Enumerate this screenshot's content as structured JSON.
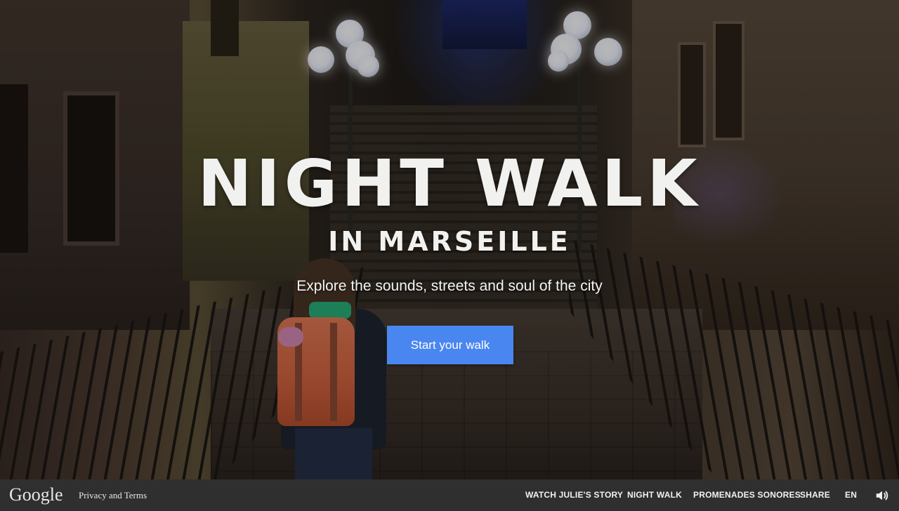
{
  "hero": {
    "title": "NIGHT WALK",
    "subtitle": "IN MARSEILLE",
    "tagline": "Explore the sounds, streets and soul of the city",
    "cta_label": "Start your walk"
  },
  "footer": {
    "logo_text": "Google",
    "privacy_label": "Privacy and Terms",
    "nav": {
      "watch_story": "WATCH JULIE'S STORY",
      "night_walk": "NIGHT WALK",
      "promenades": "PROMENADES SONORES",
      "share": "SHARE",
      "language": "EN"
    },
    "sound_icon": "speaker-icon"
  },
  "colors": {
    "cta": "#4a86f0",
    "footer_bg": "#2f2f2f",
    "text": "#ffffff"
  }
}
